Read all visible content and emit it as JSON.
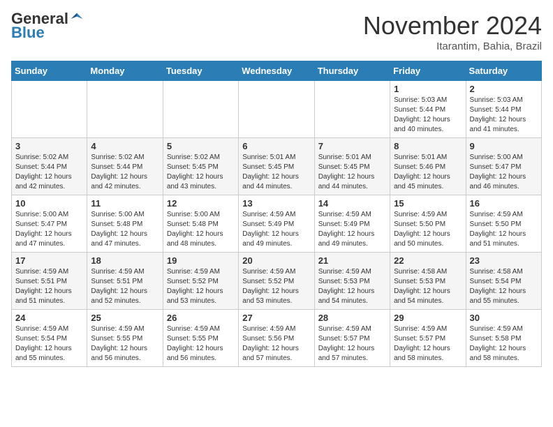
{
  "header": {
    "logo_general": "General",
    "logo_blue": "Blue",
    "month_title": "November 2024",
    "location": "Itarantim, Bahia, Brazil"
  },
  "days_of_week": [
    "Sunday",
    "Monday",
    "Tuesday",
    "Wednesday",
    "Thursday",
    "Friday",
    "Saturday"
  ],
  "weeks": [
    [
      {
        "day": "",
        "info": ""
      },
      {
        "day": "",
        "info": ""
      },
      {
        "day": "",
        "info": ""
      },
      {
        "day": "",
        "info": ""
      },
      {
        "day": "",
        "info": ""
      },
      {
        "day": "1",
        "info": "Sunrise: 5:03 AM\nSunset: 5:44 PM\nDaylight: 12 hours\nand 40 minutes."
      },
      {
        "day": "2",
        "info": "Sunrise: 5:03 AM\nSunset: 5:44 PM\nDaylight: 12 hours\nand 41 minutes."
      }
    ],
    [
      {
        "day": "3",
        "info": "Sunrise: 5:02 AM\nSunset: 5:44 PM\nDaylight: 12 hours\nand 42 minutes."
      },
      {
        "day": "4",
        "info": "Sunrise: 5:02 AM\nSunset: 5:44 PM\nDaylight: 12 hours\nand 42 minutes."
      },
      {
        "day": "5",
        "info": "Sunrise: 5:02 AM\nSunset: 5:45 PM\nDaylight: 12 hours\nand 43 minutes."
      },
      {
        "day": "6",
        "info": "Sunrise: 5:01 AM\nSunset: 5:45 PM\nDaylight: 12 hours\nand 44 minutes."
      },
      {
        "day": "7",
        "info": "Sunrise: 5:01 AM\nSunset: 5:45 PM\nDaylight: 12 hours\nand 44 minutes."
      },
      {
        "day": "8",
        "info": "Sunrise: 5:01 AM\nSunset: 5:46 PM\nDaylight: 12 hours\nand 45 minutes."
      },
      {
        "day": "9",
        "info": "Sunrise: 5:00 AM\nSunset: 5:47 PM\nDaylight: 12 hours\nand 46 minutes."
      }
    ],
    [
      {
        "day": "10",
        "info": "Sunrise: 5:00 AM\nSunset: 5:47 PM\nDaylight: 12 hours\nand 47 minutes."
      },
      {
        "day": "11",
        "info": "Sunrise: 5:00 AM\nSunset: 5:48 PM\nDaylight: 12 hours\nand 47 minutes."
      },
      {
        "day": "12",
        "info": "Sunrise: 5:00 AM\nSunset: 5:48 PM\nDaylight: 12 hours\nand 48 minutes."
      },
      {
        "day": "13",
        "info": "Sunrise: 4:59 AM\nSunset: 5:49 PM\nDaylight: 12 hours\nand 49 minutes."
      },
      {
        "day": "14",
        "info": "Sunrise: 4:59 AM\nSunset: 5:49 PM\nDaylight: 12 hours\nand 49 minutes."
      },
      {
        "day": "15",
        "info": "Sunrise: 4:59 AM\nSunset: 5:50 PM\nDaylight: 12 hours\nand 50 minutes."
      },
      {
        "day": "16",
        "info": "Sunrise: 4:59 AM\nSunset: 5:50 PM\nDaylight: 12 hours\nand 51 minutes."
      }
    ],
    [
      {
        "day": "17",
        "info": "Sunrise: 4:59 AM\nSunset: 5:51 PM\nDaylight: 12 hours\nand 51 minutes."
      },
      {
        "day": "18",
        "info": "Sunrise: 4:59 AM\nSunset: 5:51 PM\nDaylight: 12 hours\nand 52 minutes."
      },
      {
        "day": "19",
        "info": "Sunrise: 4:59 AM\nSunset: 5:52 PM\nDaylight: 12 hours\nand 53 minutes."
      },
      {
        "day": "20",
        "info": "Sunrise: 4:59 AM\nSunset: 5:52 PM\nDaylight: 12 hours\nand 53 minutes."
      },
      {
        "day": "21",
        "info": "Sunrise: 4:59 AM\nSunset: 5:53 PM\nDaylight: 12 hours\nand 54 minutes."
      },
      {
        "day": "22",
        "info": "Sunrise: 4:58 AM\nSunset: 5:53 PM\nDaylight: 12 hours\nand 54 minutes."
      },
      {
        "day": "23",
        "info": "Sunrise: 4:58 AM\nSunset: 5:54 PM\nDaylight: 12 hours\nand 55 minutes."
      }
    ],
    [
      {
        "day": "24",
        "info": "Sunrise: 4:59 AM\nSunset: 5:54 PM\nDaylight: 12 hours\nand 55 minutes."
      },
      {
        "day": "25",
        "info": "Sunrise: 4:59 AM\nSunset: 5:55 PM\nDaylight: 12 hours\nand 56 minutes."
      },
      {
        "day": "26",
        "info": "Sunrise: 4:59 AM\nSunset: 5:55 PM\nDaylight: 12 hours\nand 56 minutes."
      },
      {
        "day": "27",
        "info": "Sunrise: 4:59 AM\nSunset: 5:56 PM\nDaylight: 12 hours\nand 57 minutes."
      },
      {
        "day": "28",
        "info": "Sunrise: 4:59 AM\nSunset: 5:57 PM\nDaylight: 12 hours\nand 57 minutes."
      },
      {
        "day": "29",
        "info": "Sunrise: 4:59 AM\nSunset: 5:57 PM\nDaylight: 12 hours\nand 58 minutes."
      },
      {
        "day": "30",
        "info": "Sunrise: 4:59 AM\nSunset: 5:58 PM\nDaylight: 12 hours\nand 58 minutes."
      }
    ]
  ]
}
